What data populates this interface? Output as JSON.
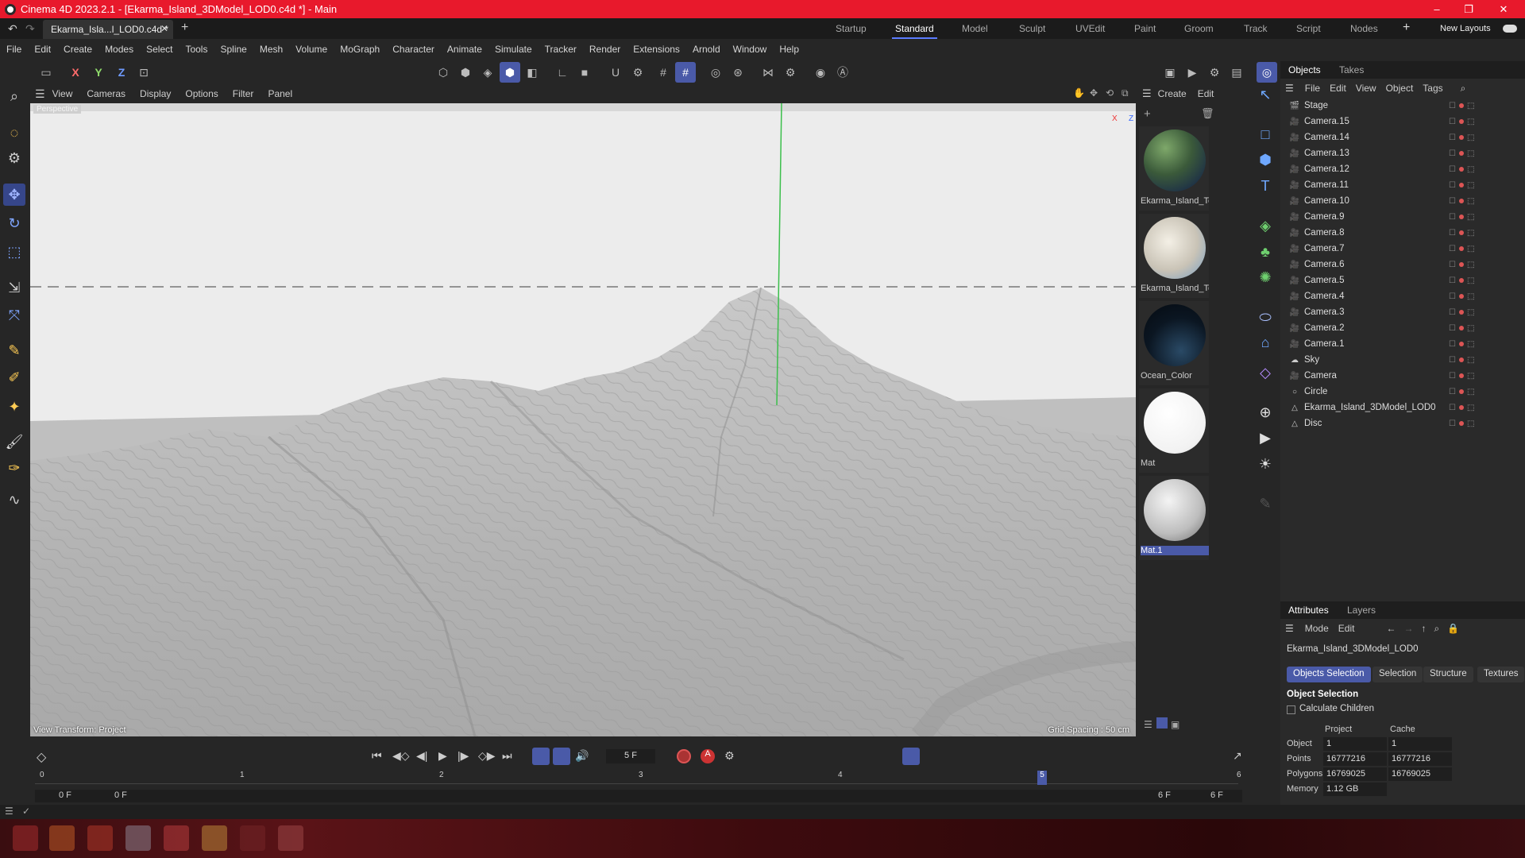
{
  "title_bar": {
    "title": "Cinema 4D 2023.2.1 - [Ekarma_Island_3DModel_LOD0.c4d *] - Main",
    "minimize": "–",
    "restore": "❐",
    "close": "✕"
  },
  "tabs": {
    "document": "Ekarma_Isla...l_LOD0.c4d *",
    "add": "+"
  },
  "layouts": {
    "items": [
      "Startup",
      "Standard",
      "Model",
      "Sculpt",
      "UVEdit",
      "Paint",
      "Groom",
      "Track",
      "Script",
      "Nodes"
    ],
    "active": "Standard",
    "add": "+",
    "new_layouts": "New Layouts"
  },
  "menu": [
    "File",
    "Edit",
    "Create",
    "Modes",
    "Select",
    "Tools",
    "Spline",
    "Mesh",
    "Volume",
    "MoGraph",
    "Character",
    "Animate",
    "Simulate",
    "Tracker",
    "Render",
    "Extensions",
    "Arnold",
    "Window",
    "Help"
  ],
  "toolbar": {
    "axes": [
      "X",
      "Y",
      "Z"
    ]
  },
  "viewport": {
    "menu": [
      "View",
      "Cameras",
      "Display",
      "Options",
      "Filter",
      "Panel"
    ],
    "camera_name": "Perspective",
    "view_transform": "View Transform: Project",
    "grid_spacing": "Grid Spacing : 50 cm",
    "axis_x": "X",
    "axis_z": "Z"
  },
  "materials": {
    "menu": [
      "Create",
      "Edit"
    ],
    "items": [
      {
        "name": "Ekarma_Island_Te"
      },
      {
        "name": "Ekarma_Island_Te"
      },
      {
        "name": "Ocean_Color"
      },
      {
        "name": "Mat"
      },
      {
        "name": "Mat.1"
      }
    ]
  },
  "objects": {
    "tabs": [
      "Objects",
      "Takes"
    ],
    "menu": [
      "File",
      "Edit",
      "View",
      "Object",
      "Tags"
    ],
    "items": [
      {
        "name": "Stage",
        "type": "stage"
      },
      {
        "name": "Camera.15",
        "type": "camera"
      },
      {
        "name": "Camera.14",
        "type": "camera"
      },
      {
        "name": "Camera.13",
        "type": "camera"
      },
      {
        "name": "Camera.12",
        "type": "camera"
      },
      {
        "name": "Camera.11",
        "type": "camera"
      },
      {
        "name": "Camera.10",
        "type": "camera"
      },
      {
        "name": "Camera.9",
        "type": "camera"
      },
      {
        "name": "Camera.8",
        "type": "camera"
      },
      {
        "name": "Camera.7",
        "type": "camera"
      },
      {
        "name": "Camera.6",
        "type": "camera"
      },
      {
        "name": "Camera.5",
        "type": "camera"
      },
      {
        "name": "Camera.4",
        "type": "camera"
      },
      {
        "name": "Camera.3",
        "type": "camera"
      },
      {
        "name": "Camera.2",
        "type": "camera"
      },
      {
        "name": "Camera.1",
        "type": "camera"
      },
      {
        "name": "Sky",
        "type": "sky"
      },
      {
        "name": "Camera",
        "type": "camera"
      },
      {
        "name": "Circle",
        "type": "circle"
      },
      {
        "name": "Ekarma_Island_3DModel_LOD0",
        "type": "mesh"
      },
      {
        "name": "Disc",
        "type": "mesh"
      }
    ]
  },
  "attributes": {
    "tabs": [
      "Attributes",
      "Layers"
    ],
    "menu": [
      "Mode",
      "Edit"
    ],
    "object_name": "Ekarma_Island_3DModel_LOD0",
    "buttons": [
      "Objects Selection",
      "Selection",
      "Structure",
      "Textures"
    ],
    "section": "Object Selection",
    "calc_children": "Calculate Children",
    "col_project": "Project",
    "col_cache": "Cache",
    "rows": [
      {
        "label": "Object",
        "project": "1",
        "cache": "1"
      },
      {
        "label": "Points",
        "project": "16777216",
        "cache": "16777216"
      },
      {
        "label": "Polygons",
        "project": "16769025",
        "cache": "16769025"
      },
      {
        "label": "Memory",
        "project": "1.12 GB",
        "cache": ""
      }
    ]
  },
  "timeline": {
    "current_frame": "5 F",
    "start": "0 F",
    "start2": "0 F",
    "end": "6 F",
    "end2": "6 F",
    "ruler": [
      "0",
      "1",
      "2",
      "3",
      "4",
      "5",
      "6"
    ],
    "playhead_frame": 5
  },
  "colors": {
    "title_red": "#e8192c",
    "accent": "#4a5aa8",
    "panel": "#262626"
  }
}
